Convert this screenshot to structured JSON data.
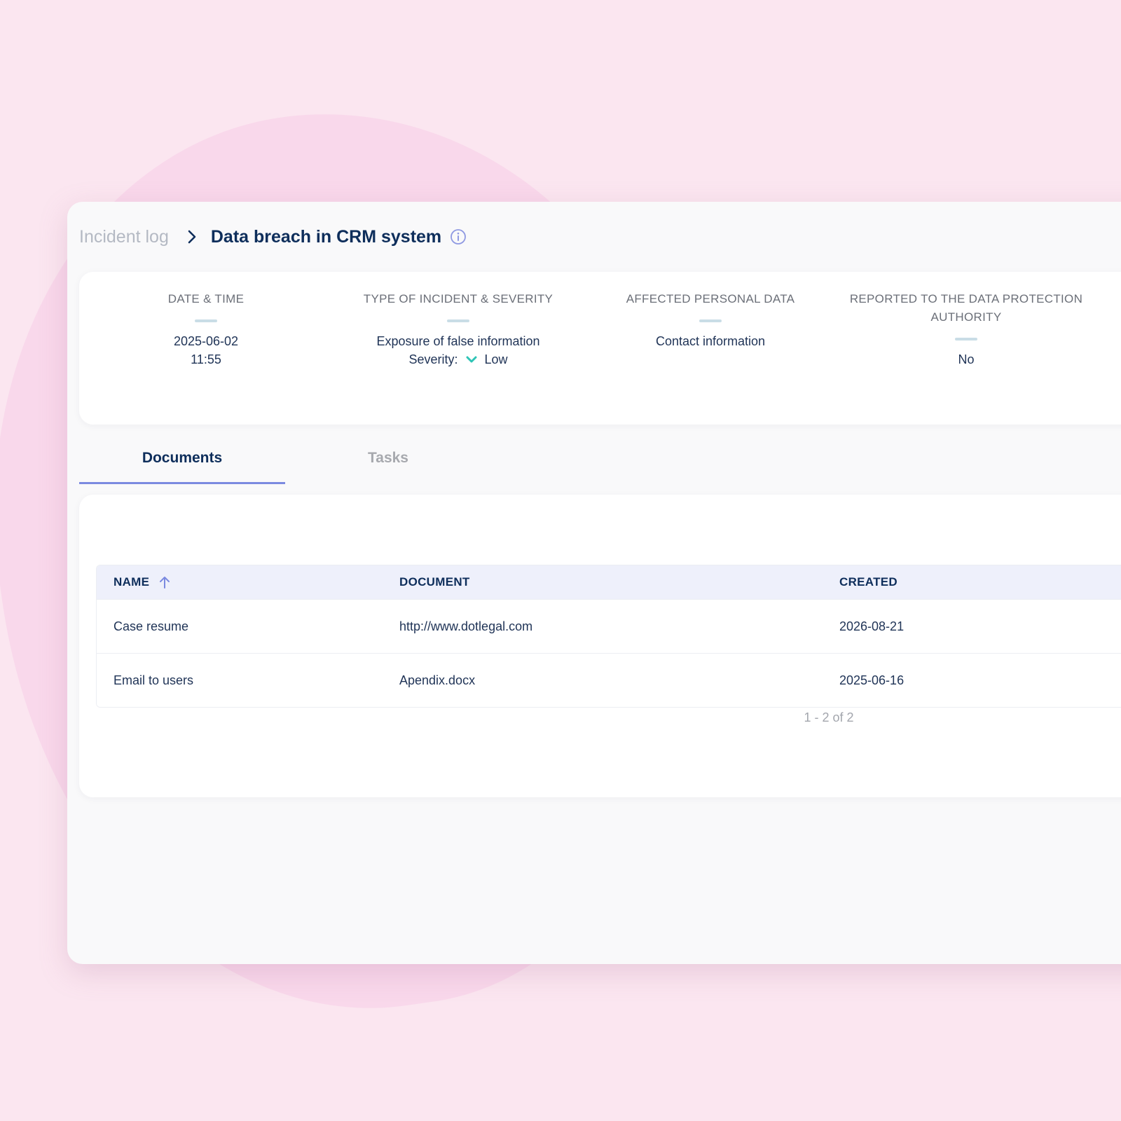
{
  "breadcrumb": {
    "parent": "Incident log",
    "current": "Data breach in CRM system"
  },
  "summary": {
    "date_time": {
      "label": "DATE & TIME",
      "date": "2025-06-02",
      "time": "11:55"
    },
    "incident": {
      "label": "TYPE OF INCIDENT & SEVERITY",
      "type": "Exposure of false information",
      "severity_label": "Severity:",
      "severity_value": "Low",
      "severity_color": "#2ec4b6"
    },
    "affected": {
      "label": "AFFECTED PERSONAL DATA",
      "value": "Contact information"
    },
    "reported": {
      "label_line1": "REPORTED TO THE DATA PROTECTION",
      "label_line2": "AUTHORITY",
      "value": "No"
    }
  },
  "tabs": [
    {
      "label": "Documents",
      "active": true
    },
    {
      "label": "Tasks",
      "active": false
    }
  ],
  "table": {
    "columns": [
      "NAME",
      "DOCUMENT",
      "CREATED"
    ],
    "rows": [
      {
        "name": "Case resume",
        "document": "http://www.dotlegal.com",
        "created": "2026-08-21"
      },
      {
        "name": "Email to users",
        "document": "Apendix.docx",
        "created": "2025-06-16"
      }
    ],
    "pagination": "1 - 2 of 2"
  },
  "icons": {
    "breadcrumb_separator": "chevron-right-icon",
    "title_info": "info-icon",
    "sort": "arrow-up-icon",
    "severity": "chevron-down-icon"
  },
  "colors": {
    "accent": "#7b8ae0",
    "title": "#0e2e5b",
    "background": "#fbe6f0"
  }
}
